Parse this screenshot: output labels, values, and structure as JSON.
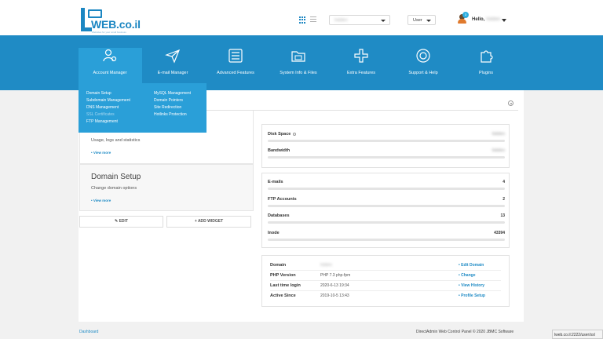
{
  "header": {
    "logo_text": "WEB.co.il",
    "logo_tagline": "Websites for your small business",
    "domain_select": "hidden",
    "role_select": "User",
    "notification_count": "3",
    "hello_label": "Hello,",
    "user_name": "hidden"
  },
  "menu": {
    "items": [
      {
        "label": "Account Manager",
        "icon": "users-gear-icon"
      },
      {
        "label": "E-mail Manager",
        "icon": "paper-plane-icon"
      },
      {
        "label": "Advanced Features",
        "icon": "list-panel-icon"
      },
      {
        "label": "System Info & Files",
        "icon": "folder-icon"
      },
      {
        "label": "Extra Features",
        "icon": "plus-icon"
      },
      {
        "label": "Support & Help",
        "icon": "lifebuoy-icon"
      },
      {
        "label": "Plugins",
        "icon": "puzzle-icon"
      }
    ]
  },
  "dropdown": {
    "col1": [
      "Domain Setup",
      "Subdomain Management",
      "DNS Management",
      "SSL Certificates",
      "FTP Management"
    ],
    "col2": [
      "MySQL Management",
      "Domain Pointers",
      "Site Redirection",
      "Hotlinks Protection"
    ]
  },
  "widgets": {
    "w1": {
      "desc": "Usage, logs and statistics",
      "more": "• View more"
    },
    "w2": {
      "title": "Domain Setup",
      "desc": "Change domain options",
      "more": "• View more"
    },
    "edit_label": "EDIT",
    "add_label": "ADD WIDGET"
  },
  "usage": {
    "disk_label": "Disk Space",
    "disk_value": "hidden",
    "bandwidth_label": "Bandwidth",
    "bandwidth_value": "hidden"
  },
  "counts": [
    {
      "label": "E-mails",
      "value": "4"
    },
    {
      "label": "FTP Accounts",
      "value": "2"
    },
    {
      "label": "Databases",
      "value": "13"
    },
    {
      "label": "Inode",
      "value": "43394"
    }
  ],
  "info": [
    {
      "key": "Domain",
      "value": "hidden",
      "action": "• Edit Domain"
    },
    {
      "key": "PHP Version",
      "value": "PHP 7.3 php-fpm",
      "action": "• Change"
    },
    {
      "key": "Last time login",
      "value": "2020-6-13 19:34",
      "action": "• View History"
    },
    {
      "key": "Active Since",
      "value": "2019-10-5 13:43",
      "action": "• Profile Setup"
    }
  ],
  "footer": {
    "left": "Dashboard",
    "right": "DirectAdmin Web Control Panel © 2020 JBMC Software",
    "url": "lweb.co.il:2222/user/ssl"
  },
  "colors": {
    "brand_blue": "#1f8bc5",
    "active_blue": "#2a9fd8"
  }
}
